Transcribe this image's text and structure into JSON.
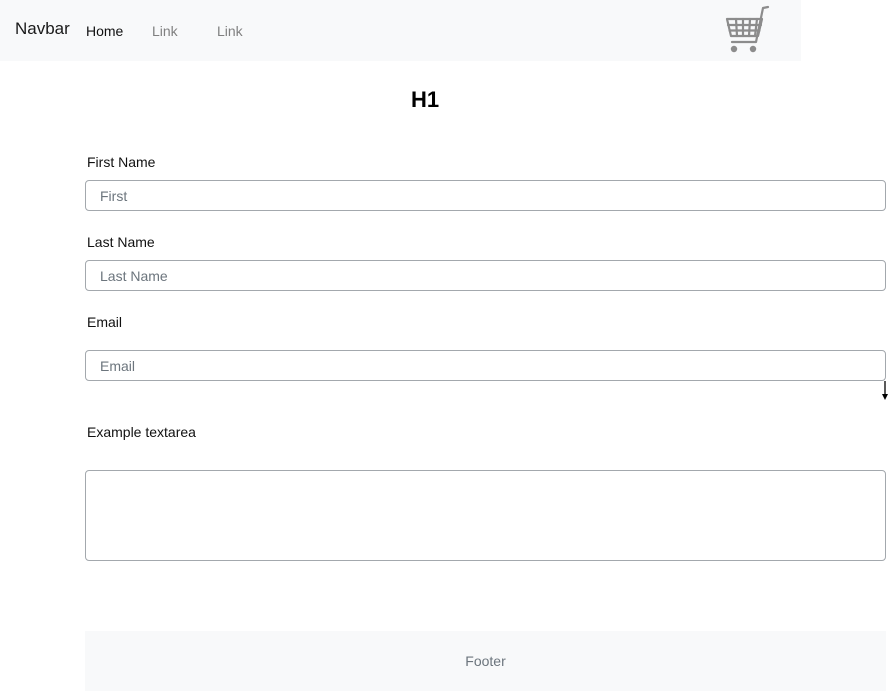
{
  "navbar": {
    "brand": "Navbar",
    "links": [
      {
        "label": "Home",
        "active": true
      },
      {
        "label": "Link",
        "active": false
      },
      {
        "label": "Link",
        "active": false
      }
    ],
    "cart_icon": "shopping-cart-icon"
  },
  "heading": "H1",
  "form": {
    "first_name": {
      "label": "First Name",
      "placeholder": "First",
      "value": ""
    },
    "last_name": {
      "label": "Last Name",
      "placeholder": "Last Name",
      "value": ""
    },
    "email": {
      "label": "Email",
      "placeholder": "Email",
      "value": ""
    },
    "textarea": {
      "label": "Example textarea",
      "value": ""
    }
  },
  "footer": {
    "text": "Footer"
  },
  "colors": {
    "navbar_bg": "#f8f9fa",
    "footer_bg": "#f8f9fa",
    "input_border": "#a3a8ad"
  }
}
